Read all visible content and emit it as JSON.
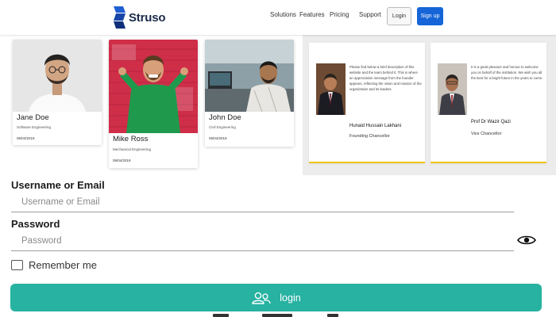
{
  "nav": {
    "brand": "Struso",
    "links": [
      "Solutions",
      "Features",
      "Pricing",
      "Support"
    ],
    "login_label": "Login",
    "signup_label": "Sign up"
  },
  "team": [
    {
      "name": "Jane Doe",
      "role": "Software Engineering",
      "date": "06/04/2019"
    },
    {
      "name": "Mike Ross",
      "role": "Mechanical Engineering",
      "date": "06/04/2019"
    },
    {
      "name": "John Doe",
      "role": "Civil Engineering",
      "date": "06/04/2019"
    }
  ],
  "testimonials": [
    {
      "quote": "Please find below a brief description of this website and the team behind it. This is where an appreciation message from the founder appears, reflecting the vision and mission of the organization and its leaders.",
      "name": "Hunaid Hussain Lakhani",
      "title": "Founding Chancellor"
    },
    {
      "quote": "It is a great pleasure and honour to welcome you on behalf of the institution. We wish you all the best for a bright future in the years to come.",
      "name": "Prof Dr Wazir Qazi",
      "title": "Vice Chancellor"
    }
  ],
  "form": {
    "username_label": "Username or Email",
    "username_placeholder": "Username or Email",
    "password_label": "Password",
    "password_placeholder": "Password",
    "remember_label": "Remember me",
    "login_label": "login"
  },
  "icons": {
    "logo": "struso-logo-icon",
    "eye": "eye-icon",
    "login": "users-icon"
  },
  "colors": {
    "accent": "#27b2a1",
    "signup": "#1565d8",
    "testimonial_border": "#f0c419"
  }
}
